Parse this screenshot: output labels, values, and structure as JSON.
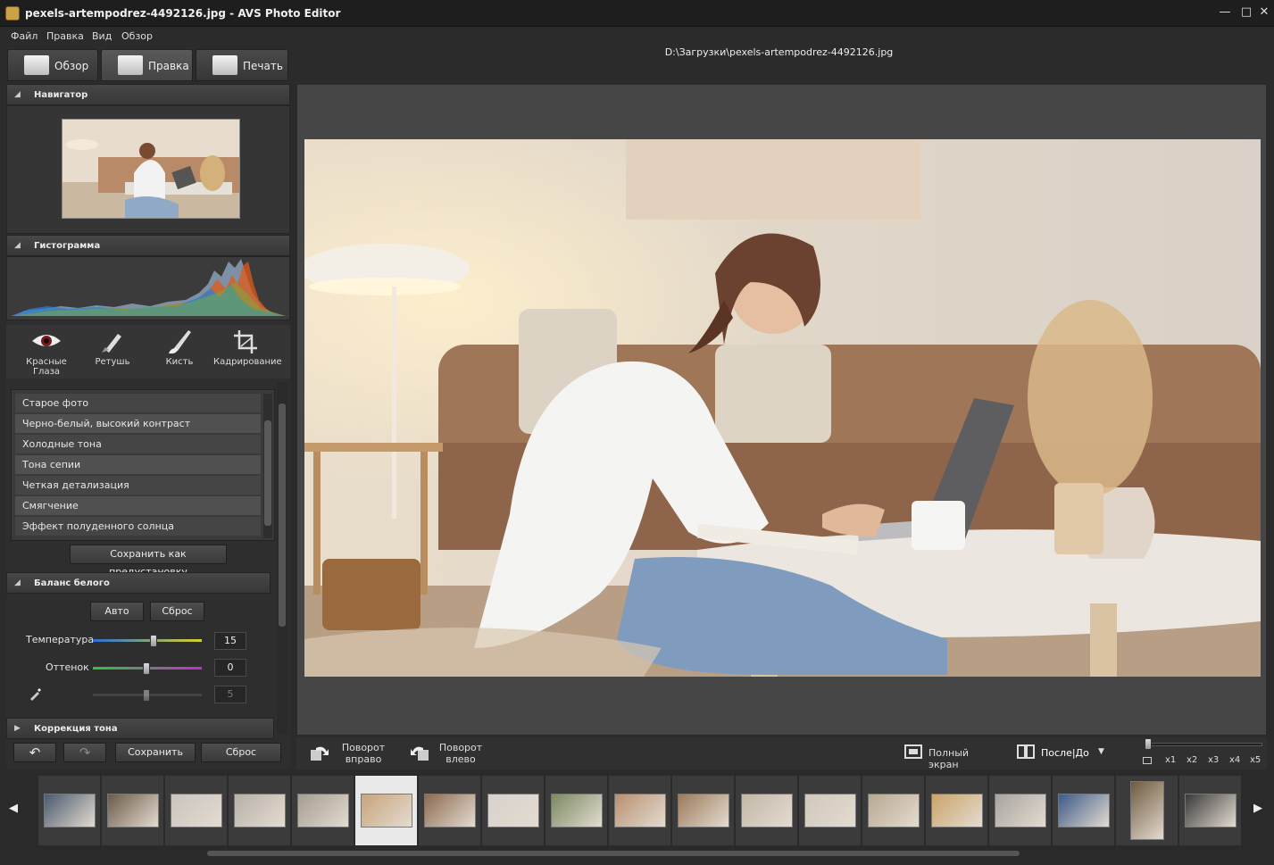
{
  "window": {
    "title": "pexels-artempodrez-4492126.jpg  -  AVS Photo Editor",
    "minimize": "—",
    "maximize": "□",
    "close": "✕"
  },
  "menu": [
    "Файл",
    "Правка",
    "Вид",
    "Обзор"
  ],
  "tabs": [
    {
      "label": "Обзор",
      "icon": "browse-icon"
    },
    {
      "label": "Правка",
      "icon": "edit-icon",
      "active": true
    },
    {
      "label": "Печать",
      "icon": "print-icon"
    }
  ],
  "file_path": "D:\\Загрузки\\pexels-artempodrez-4492126.jpg",
  "panels": {
    "navigator": "Навигатор",
    "histogram": "Гистограмма",
    "white_balance": "Баланс белого",
    "tone_correction": "Коррекция тона"
  },
  "tools": [
    {
      "label": "Красные Глаза",
      "icon": "red-eye-icon"
    },
    {
      "label": "Ретушь",
      "icon": "retouch-brush-icon"
    },
    {
      "label": "Кисть",
      "icon": "brush-icon"
    },
    {
      "label": "Кадрирование",
      "icon": "crop-icon"
    }
  ],
  "presets": [
    "Старое фото",
    "Черно-белый, высокий контраст",
    "Холодные тона",
    "Тона сепии",
    "Четкая детализация",
    "Смягчение",
    "Эффект полуденного солнца"
  ],
  "save_preset_label": "Сохранить как предустановку",
  "white_balance": {
    "auto_label": "Авто",
    "reset_label": "Сброс",
    "temperature_label": "Температура",
    "temperature_value": "15",
    "tint_label": "Оттенок",
    "tint_value": "0",
    "picker_value": "5"
  },
  "left_footer": {
    "undo": "↶",
    "redo": "↷",
    "save_label": "Сохранить",
    "reset_label": "Сброс"
  },
  "bottom_toolbar": {
    "rotate_right": "Поворот вправо",
    "rotate_left": "Поворот влево",
    "fullscreen": "Полный экран",
    "after_before": "После|До",
    "zoom_levels": [
      "x1",
      "x2",
      "x3",
      "x4",
      "x5"
    ]
  },
  "filmstrip": {
    "left_arrow": "◀",
    "right_arrow": "▶",
    "selected_index": 5,
    "thumb_count": 19
  },
  "colors": {
    "background": "#2b2b2b",
    "panel": "#353535",
    "canvas": "#464646",
    "accent_selected": "#e9e9e9"
  }
}
